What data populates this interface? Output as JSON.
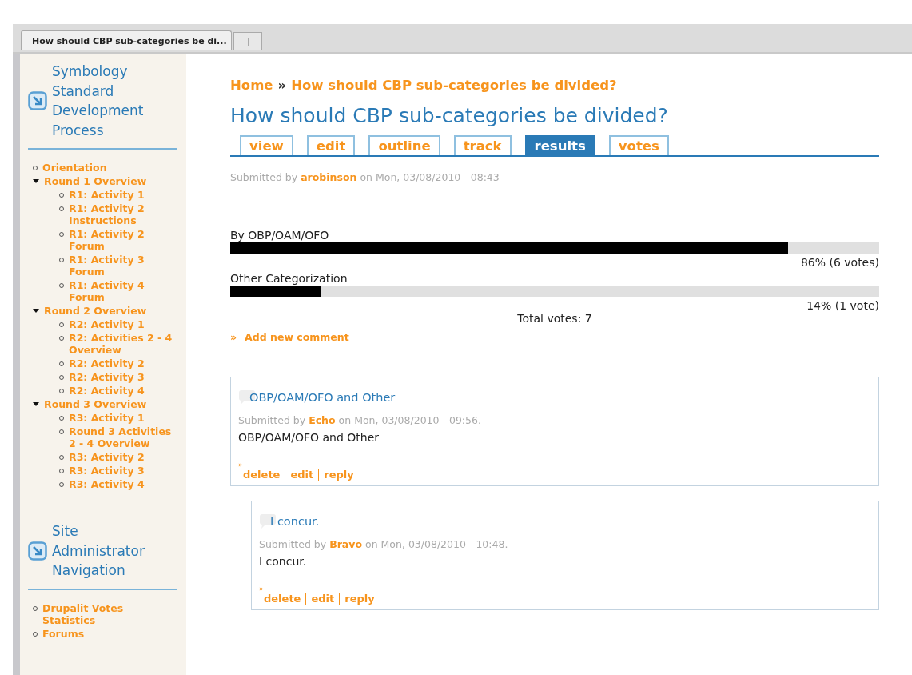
{
  "browser": {
    "tab_title": "How should CBP sub-categories be di..."
  },
  "sidebar": {
    "blocks": [
      {
        "title": "Symbology Standard Development Process",
        "items": [
          {
            "label": "Orientation"
          },
          {
            "label": "Round 1 Overview",
            "expanded": true,
            "children": [
              {
                "label": "R1: Activity 1"
              },
              {
                "label": "R1: Activity 2 Instructions"
              },
              {
                "label": "R1: Activity 2 Forum"
              },
              {
                "label": "R1: Activity 3 Forum"
              },
              {
                "label": "R1: Activity 4 Forum"
              }
            ]
          },
          {
            "label": "Round 2 Overview",
            "expanded": true,
            "children": [
              {
                "label": "R2: Activity 1"
              },
              {
                "label": "R2: Activities 2 - 4 Overview"
              },
              {
                "label": "R2: Activity 2"
              },
              {
                "label": "R2: Activity 3"
              },
              {
                "label": "R2: Activity 4"
              }
            ]
          },
          {
            "label": "Round 3 Overview",
            "expanded": true,
            "children": [
              {
                "label": "R3: Activity 1"
              },
              {
                "label": "Round 3 Activities 2 - 4 Overview"
              },
              {
                "label": "R3: Activity 2"
              },
              {
                "label": "R3: Activity 3"
              },
              {
                "label": "R3: Activity 4"
              }
            ]
          }
        ]
      },
      {
        "title": "Site Administrator Navigation",
        "items": [
          {
            "label": "Drupalit Votes Statistics"
          },
          {
            "label": "Forums"
          }
        ]
      }
    ]
  },
  "breadcrumb": {
    "home": "Home",
    "separator": "»",
    "current": "How should CBP sub-categories be divided?"
  },
  "page_title": "How should CBP sub-categories be divided?",
  "tabs": [
    {
      "label": "view",
      "selected": false
    },
    {
      "label": "edit",
      "selected": false
    },
    {
      "label": "outline",
      "selected": false
    },
    {
      "label": "track",
      "selected": false
    },
    {
      "label": "results",
      "selected": true
    },
    {
      "label": "votes",
      "selected": false
    }
  ],
  "submitted": {
    "prefix": "Submitted by",
    "author": "arobinson",
    "suffix": "on Mon, 03/08/2010 - 08:43"
  },
  "poll": {
    "choices": [
      {
        "label": "By OBP/OAM/OFO",
        "level": 0.86,
        "reading": "86% (6 votes)"
      },
      {
        "label": "Other Categorization",
        "level": 0.14,
        "reading": "14% (1 vote)"
      }
    ],
    "total": "Total votes: 7"
  },
  "add_comment": {
    "bullet": "»",
    "label": "Add new comment"
  },
  "comments": [
    {
      "title": "OBP/OAM/OFO and Other",
      "prefix": "Submitted by",
      "author": "Echo",
      "suffix": "on Mon, 03/08/2010 - 09:56.",
      "body": "OBP/OAM/OFO and Other",
      "bullet": "»",
      "links": [
        "delete",
        "edit",
        "reply"
      ],
      "children": [
        {
          "title": "I concur.",
          "prefix": "Submitted by",
          "author": "Bravo",
          "suffix": "on Mon, 03/08/2010 - 10:48.",
          "body": "I concur.",
          "bullet": "»",
          "links": [
            "delete",
            "edit",
            "reply"
          ]
        }
      ]
    }
  ]
}
